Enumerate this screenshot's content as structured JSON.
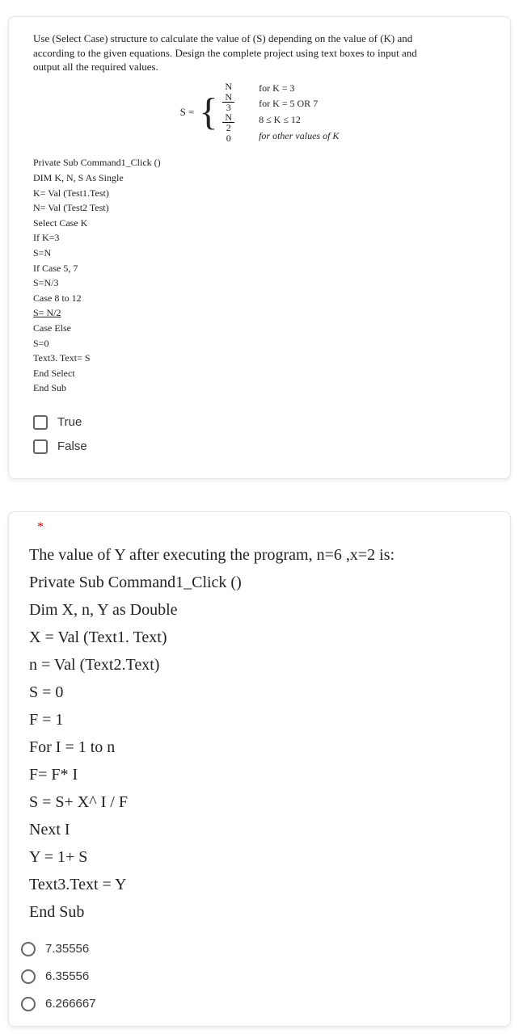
{
  "q1": {
    "intro": "Use (Select Case) structure to calculate the value of (S) depending on the value of (K) and according to the given equations. Design the complete project using text boxes to input and output all the required values.",
    "eq_label": "S =",
    "cases_left": [
      "N",
      "N",
      "3",
      "N",
      "2",
      "0"
    ],
    "cases_right": [
      "for K = 3",
      "for K = 5 OR 7",
      "8 ≤ K  ≤  12",
      "for other values of K"
    ],
    "code": [
      "Private Sub Command1_Click ()",
      "DIM K, N, S As Single",
      "K= Val (Test1.Test)",
      "N= Val (Test2 Test)",
      "Select Case K",
      "If K=3",
      "S=N",
      "If Case 5, 7",
      "S=N/3",
      "Case 8 to 12",
      "S= N/2",
      "Case Else",
      "S=0",
      "Text3. Text= S",
      "End Select",
      "End Sub"
    ],
    "options": [
      "True",
      "False"
    ]
  },
  "q2": {
    "asterisk": "*",
    "prompt_line": "The value of Y after executing the program, n=6 ,x=2 is:",
    "code": [
      "Private Sub Command1_Click ()",
      "Dim X, n, Y as Double",
      "X = Val (Text1. Text)",
      "n = Val (Text2.Text)",
      "S = 0",
      "F = 1",
      "For I = 1 to n",
      "F= F* I",
      "S = S+ X^ I / F",
      "Next I",
      "Y = 1+ S",
      "Text3.Text = Y",
      "End Sub"
    ],
    "options": [
      "7.35556",
      "6.35556",
      "6.266667"
    ]
  }
}
